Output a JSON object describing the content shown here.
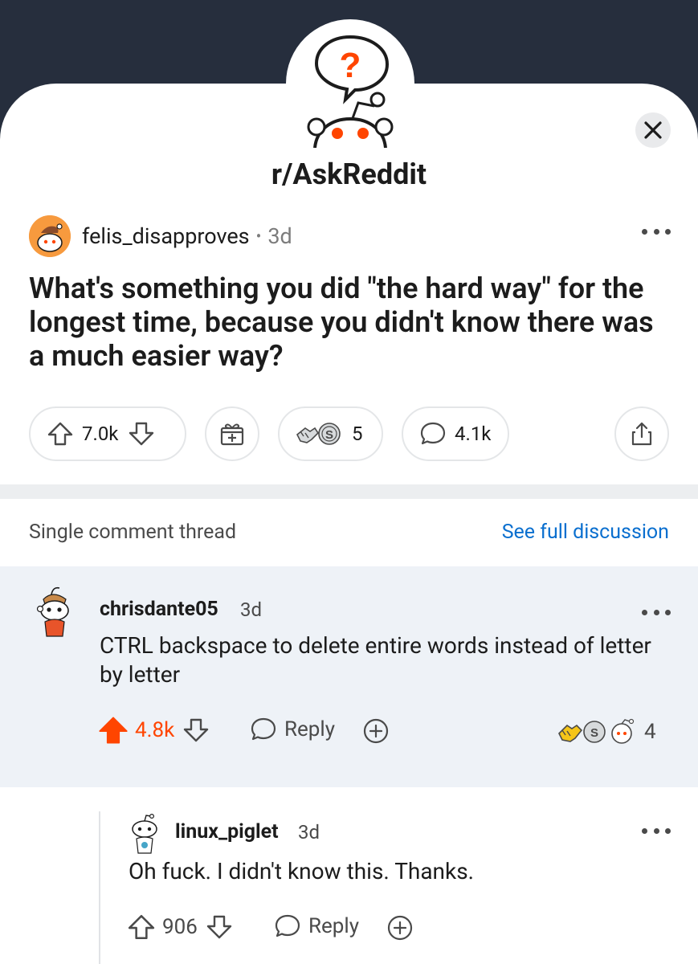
{
  "subreddit": {
    "name": "r/AskReddit",
    "icon": "askreddit-question-snoo-icon"
  },
  "close_icon": "close-icon",
  "post": {
    "author": "felis_disapproves",
    "separator": "•",
    "age": "3d",
    "title": "What's something you did \"the hard way\" for the longest time, because you didn't know there was a much easier way?",
    "upvotes": "7.0k",
    "awards_count": "5",
    "comments": "4.1k"
  },
  "thread": {
    "label": "Single comment thread",
    "see_full": "See full discussion"
  },
  "comment": {
    "author": "chrisdante05",
    "age": "3d",
    "body": "CTRL backspace to delete entire words instead of letter by letter",
    "score": "4.8k",
    "reply_label": "Reply",
    "awards_count": "4",
    "upvoted_color": "#ff4500"
  },
  "reply": {
    "author": "linux_piglet",
    "age": "3d",
    "body": "Oh fuck. I didn't know this. Thanks.",
    "score": "906",
    "reply_label": "Reply"
  }
}
